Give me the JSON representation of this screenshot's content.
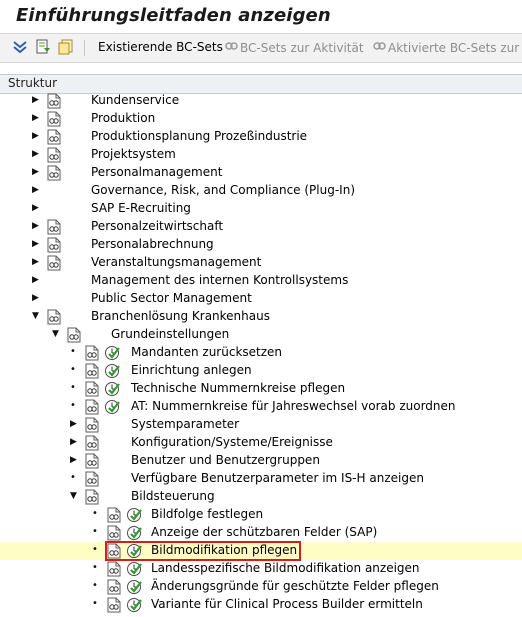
{
  "title": "Einführungsleitfaden anzeigen",
  "toolbar": {
    "icons": [
      "expand-all-icon",
      "doc-find-icon",
      "doc-copy-icon"
    ],
    "buttons": [
      {
        "label": "Existierende BC-Sets",
        "disabled": false
      },
      {
        "label": "BC-Sets zur Aktivität",
        "disabled": true
      },
      {
        "label": "Aktivierte BC-Sets zur A",
        "disabled": true
      }
    ]
  },
  "header": "Struktur",
  "tree": [
    {
      "label": "Kundenservice",
      "level": 0,
      "expander": "collapsed",
      "doc": true,
      "exec": false
    },
    {
      "label": "Produktion",
      "level": 0,
      "expander": "collapsed",
      "doc": true,
      "exec": false
    },
    {
      "label": "Produktionsplanung Prozeßindustrie",
      "level": 0,
      "expander": "collapsed",
      "doc": true,
      "exec": false
    },
    {
      "label": "Projektsystem",
      "level": 0,
      "expander": "collapsed",
      "doc": true,
      "exec": false
    },
    {
      "label": "Personalmanagement",
      "level": 0,
      "expander": "collapsed",
      "doc": true,
      "exec": false
    },
    {
      "label": "Governance, Risk, and Compliance (Plug-In)",
      "level": 0,
      "expander": "collapsed",
      "doc": false,
      "exec": false
    },
    {
      "label": "SAP E-Recruiting",
      "level": 0,
      "expander": "collapsed",
      "doc": false,
      "exec": false
    },
    {
      "label": "Personalzeitwirtschaft",
      "level": 0,
      "expander": "collapsed",
      "doc": true,
      "exec": false
    },
    {
      "label": "Personalabrechnung",
      "level": 0,
      "expander": "collapsed",
      "doc": true,
      "exec": false
    },
    {
      "label": "Veranstaltungsmanagement",
      "level": 0,
      "expander": "collapsed",
      "doc": true,
      "exec": false
    },
    {
      "label": "Management des internen Kontrollsystems",
      "level": 0,
      "expander": "collapsed",
      "doc": false,
      "exec": false
    },
    {
      "label": "Public Sector Management",
      "level": 0,
      "expander": "collapsed",
      "doc": false,
      "exec": false
    },
    {
      "label": "Branchenlösung Krankenhaus",
      "level": 0,
      "expander": "expanded",
      "doc": true,
      "exec": false
    },
    {
      "label": "Grundeinstellungen",
      "level": 1,
      "expander": "expanded",
      "doc": true,
      "exec": false
    },
    {
      "label": "Mandanten zurücksetzen",
      "level": 2,
      "expander": "leaf",
      "doc": true,
      "exec": true
    },
    {
      "label": "Einrichtung anlegen",
      "level": 2,
      "expander": "leaf",
      "doc": true,
      "exec": true
    },
    {
      "label": "Technische Nummernkreise pflegen",
      "level": 2,
      "expander": "leaf",
      "doc": true,
      "exec": true
    },
    {
      "label": "AT: Nummernkreise für Jahreswechsel vorab zuordnen",
      "level": 2,
      "expander": "leaf",
      "doc": true,
      "exec": true
    },
    {
      "label": "Systemparameter",
      "level": 2,
      "expander": "collapsed",
      "doc": true,
      "exec": false
    },
    {
      "label": "Konfiguration/Systeme/Ereignisse",
      "level": 2,
      "expander": "collapsed",
      "doc": true,
      "exec": false
    },
    {
      "label": "Benutzer und Benutzergruppen",
      "level": 2,
      "expander": "collapsed",
      "doc": true,
      "exec": false
    },
    {
      "label": "Verfügbare Benutzerparameter im IS-H anzeigen",
      "level": 2,
      "expander": "leaf",
      "doc": true,
      "exec": false
    },
    {
      "label": "Bildsteuerung",
      "level": 2,
      "expander": "expanded",
      "doc": true,
      "exec": false
    },
    {
      "label": "Bildfolge festlegen",
      "level": 3,
      "expander": "leaf",
      "doc": true,
      "exec": true
    },
    {
      "label": "Anzeige der schützbaren Felder (SAP)",
      "level": 3,
      "expander": "leaf",
      "doc": true,
      "exec": true
    },
    {
      "label": "Bildmodifikation pflegen",
      "level": 3,
      "expander": "leaf",
      "doc": true,
      "exec": true,
      "selected": true
    },
    {
      "label": "Landesspezifische Bildmodifikation anzeigen",
      "level": 3,
      "expander": "leaf",
      "doc": true,
      "exec": true
    },
    {
      "label": "Änderungsgründe für geschützte Felder pflegen",
      "level": 3,
      "expander": "leaf",
      "doc": true,
      "exec": true
    },
    {
      "label": "Variante für Clinical Process Builder ermitteln",
      "level": 3,
      "expander": "leaf",
      "doc": true,
      "exec": true
    }
  ]
}
